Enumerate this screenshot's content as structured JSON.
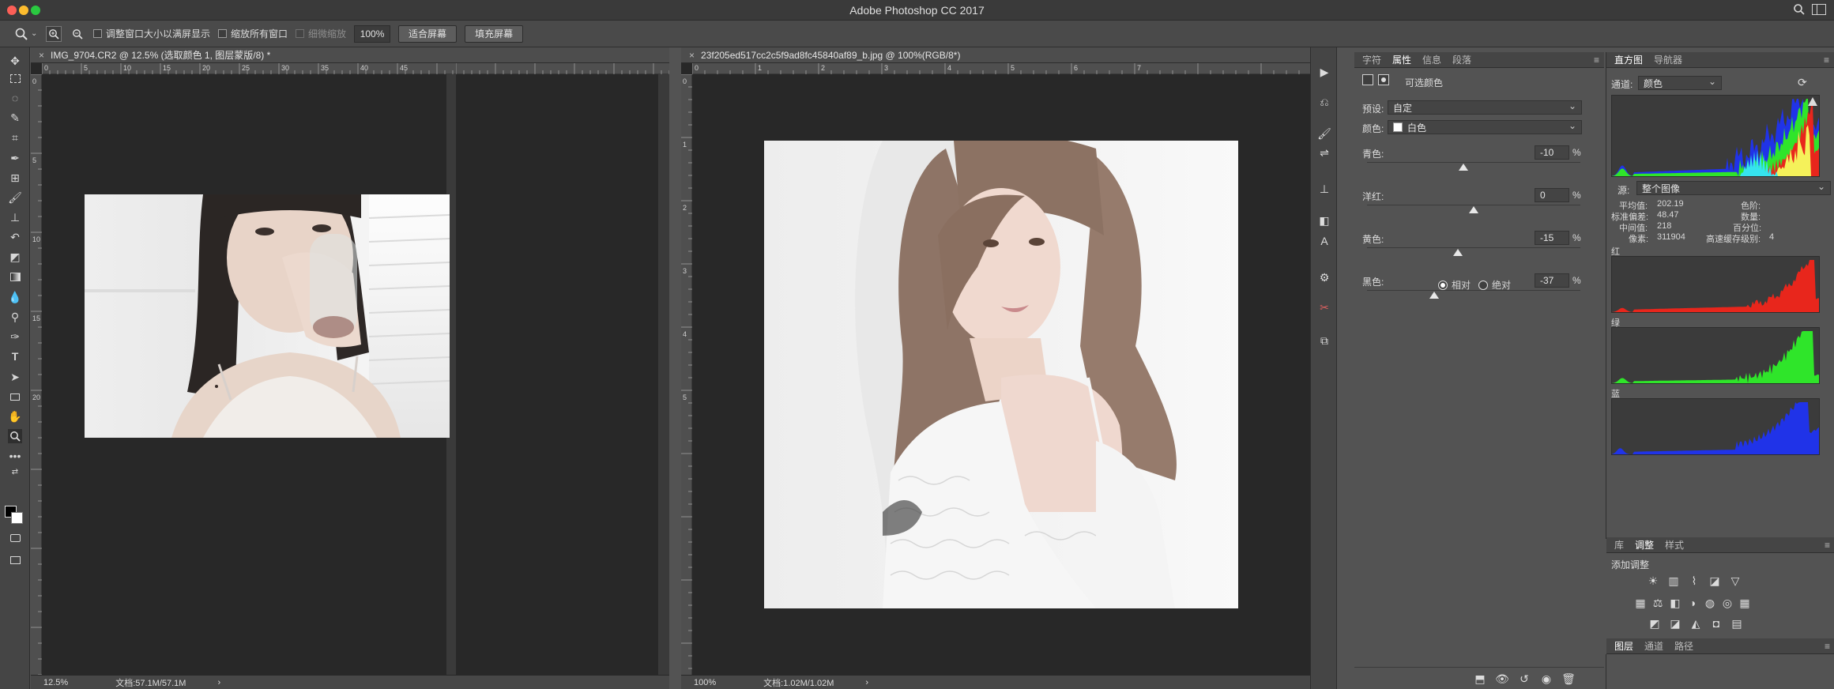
{
  "window": {
    "title": "Adobe Photoshop CC 2017"
  },
  "options_bar": {
    "resize_windows_label": "调整窗口大小以满屏显示",
    "zoom_all_label": "缩放所有窗口",
    "scrubby_zoom_label": "细微缩放",
    "zoom_value": "100%",
    "fit_screen_label": "适合屏幕",
    "fill_screen_label": "填充屏幕"
  },
  "documents": [
    {
      "tab_title": "IMG_9704.CR2 @ 12.5% (选取颜色 1, 图层蒙版/8) *",
      "zoom": "12.5%",
      "doc_size": "文档:57.1M/57.1M",
      "ruler_h": [
        "0",
        "5",
        "10",
        "15",
        "20",
        "25",
        "30",
        "35",
        "40",
        "45"
      ],
      "ruler_v": [
        "0",
        "5",
        "1\n0",
        "1\n5",
        "2\n0"
      ]
    },
    {
      "tab_title": "23f205ed517cc2c5f9ad8fc45840af89_b.jpg @ 100%(RGB/8*)",
      "zoom": "100%",
      "doc_size": "文档:1.02M/1.02M",
      "ruler_h": [
        "0",
        "1",
        "2",
        "3",
        "4",
        "5",
        "6",
        "7"
      ],
      "ruler_v": [
        "0",
        "1",
        "2",
        "3",
        "4",
        "5"
      ]
    }
  ],
  "properties_panel": {
    "tabs": [
      "字符",
      "属性",
      "信息",
      "段落"
    ],
    "active_tab": "属性",
    "title": "可选颜色",
    "preset_label": "预设:",
    "preset_value": "自定",
    "colors_label": "颜色:",
    "colors_value": "白色",
    "sliders": [
      {
        "label": "青色:",
        "value": "-10",
        "percent": -10
      },
      {
        "label": "洋红:",
        "value": "0",
        "percent": 0
      },
      {
        "label": "黄色:",
        "value": "-15",
        "percent": -15
      },
      {
        "label": "黑色:",
        "value": "-37",
        "percent": -37
      }
    ],
    "unit": "%",
    "method_relative": "相对",
    "method_absolute": "绝对",
    "method_selected": "relative"
  },
  "histogram_panel": {
    "tabs": [
      "直方图",
      "导航器"
    ],
    "channel_label": "通道:",
    "channel_value": "颜色",
    "source_label": "源:",
    "source_value": "整个图像",
    "stats": {
      "mean_label": "平均值:",
      "mean": "202.19",
      "stddev_label": "标准偏差:",
      "stddev": "48.47",
      "median_label": "中间值:",
      "median": "218",
      "pixels_label": "像素:",
      "pixels": "311904",
      "level_label": "色阶:",
      "count_label": "数量:",
      "percentile_label": "百分位:",
      "cache_label": "高速缓存级别:",
      "cache_level": "4"
    },
    "channels": [
      {
        "name": "红",
        "color": "#e8261c"
      },
      {
        "name": "绿",
        "color": "#2fe52a"
      },
      {
        "name": "蓝",
        "color": "#2033e8"
      }
    ]
  },
  "adjustments_panel": {
    "tabs": [
      "库",
      "调整",
      "样式"
    ],
    "active_tab": "调整",
    "add_adjustment_label": "添加调整"
  },
  "layers_panel": {
    "tabs": [
      "图层",
      "通道",
      "路径"
    ],
    "active_tab": "图层"
  }
}
